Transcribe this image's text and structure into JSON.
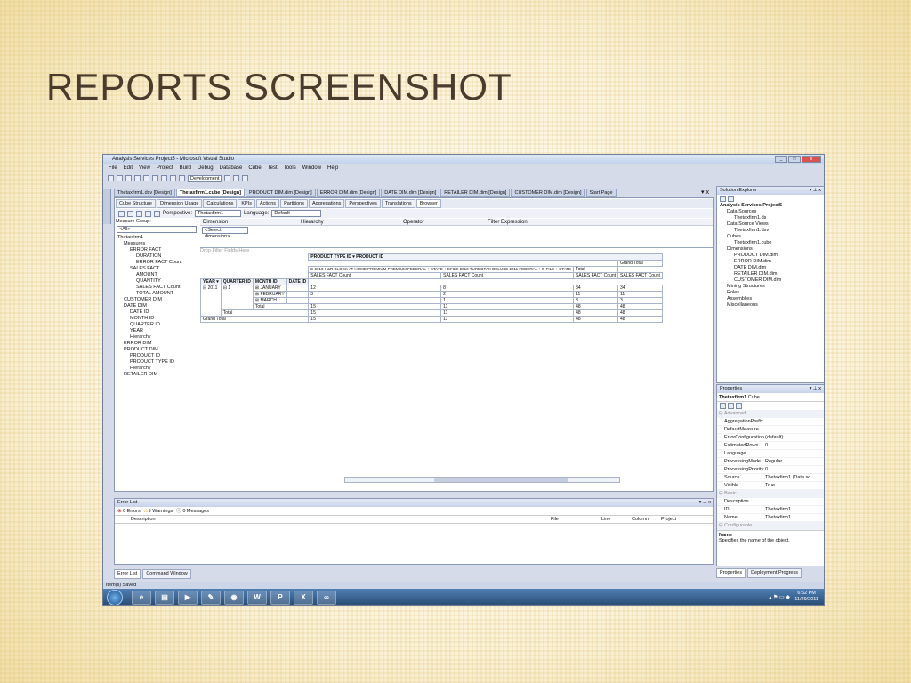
{
  "slide": {
    "title": "REPORTS SCREENSHOT"
  },
  "window": {
    "title": "Analysis Services Project5 - Microsoft Visual Studio",
    "menu": [
      "File",
      "Edit",
      "View",
      "Project",
      "Build",
      "Debug",
      "Database",
      "Cube",
      "Test",
      "Tools",
      "Window",
      "Help"
    ],
    "config": "Development"
  },
  "doc_tabs": [
    "Thetaxfirm1.dsv [Design]",
    "Thetaxfirm1.cube [Design]",
    "PRODUCT DIM.dim [Design]",
    "ERROR DIM.dim [Design]",
    "DATE DIM.dim [Design]",
    "RETAILER DIM.dim [Design]",
    "CUSTOMER DIM.dim [Design]",
    "Start Page"
  ],
  "sub_tabs": [
    "Cube Structure",
    "Dimension Usage",
    "Calculations",
    "KPIs",
    "Actions",
    "Partitions",
    "Aggregations",
    "Perspectives",
    "Translations",
    "Browser"
  ],
  "browser": {
    "perspective_label": "Perspective:",
    "perspective": "Thetaxfirm1",
    "language_label": "Language:",
    "language": "Default",
    "measure_group_label": "Measure Group:",
    "measure_group": "<All>"
  },
  "measure_tree": [
    "Thetaxfirm1",
    "Measures",
    "ERROR FACT",
    "DURATION",
    "ERROR FACT Count",
    "SALES FACT",
    "AMOUNT",
    "QUANTITY",
    "SALES FACT Count",
    "TOTAL AMOUNT",
    "CUSTOMER DIM",
    "DATE DIM",
    "DATE ID",
    "MONTH ID",
    "QUARTER ID",
    "YEAR",
    "Hierarchy",
    "ERROR DIM",
    "PRODUCT DIM",
    "PRODUCT ID",
    "PRODUCT TYPE ID",
    "Hierarchy",
    "RETAILER DIM"
  ],
  "filter": {
    "headers": [
      "Dimension",
      "Hierarchy",
      "Operator",
      "Filter Expression"
    ],
    "select_dim": "<Select dimension>"
  },
  "pivot": {
    "drop_hint": "Drop Filter Fields Here",
    "col_header": "PRODUCT TYPE ID ▾  PRODUCT ID",
    "product_header": "E 2010 H&R BLOCK AT HOME PREMIUM PREMIUM FEDERAL + STATE + EFILE 2010 TURBOTAX DELUXE 2011 FEDERAL + E-FILE + STATE",
    "total": "Total",
    "grand_total": "Grand Total",
    "measure_label": "SALES FACT Count",
    "row_headers": [
      "YEAR ▾",
      "QUARTER ID",
      "MONTH ID",
      "DATE ID"
    ],
    "year": "2011",
    "quarter": "1",
    "months": [
      "JANUARY",
      "FEBRUARY",
      "MARCH"
    ],
    "rows": [
      {
        "c1": "12",
        "c2": "8",
        "c3": "34",
        "c4": "34"
      },
      {
        "c1": "3",
        "c2": "2",
        "c3": "11",
        "c4": "11"
      },
      {
        "c1": "",
        "c2": "1",
        "c3": "3",
        "c4": "3"
      },
      {
        "c1": "15",
        "c2": "11",
        "c3": "48",
        "c4": "48"
      },
      {
        "c1": "15",
        "c2": "11",
        "c3": "48",
        "c4": "48"
      },
      {
        "c1": "15",
        "c2": "11",
        "c3": "48",
        "c4": "48"
      }
    ]
  },
  "solution": {
    "title": "Solution Explorer",
    "items": [
      "Analysis Services Project5",
      "Data Sources",
      "Thetaxfirm1.ds",
      "Data Source Views",
      "Thetaxfirm1.dsv",
      "Cubes",
      "Thetaxfirm1.cube",
      "Dimensions",
      "PRODUCT DIM.dim",
      "ERROR DIM.dim",
      "DATE DIM.dim",
      "RETAILER DIM.dim",
      "CUSTOMER DIM.dim",
      "Mining Structures",
      "Roles",
      "Assemblies",
      "Miscellaneous"
    ]
  },
  "properties": {
    "title": "Properties",
    "object": "Thetaxfirm1",
    "object_type": "Cube",
    "cat_advanced": "Advanced",
    "cat_basic": "Basic",
    "cat_configurable": "Configurable",
    "advanced": [
      {
        "k": "AggregationPrefix",
        "v": ""
      },
      {
        "k": "DefaultMeasure",
        "v": ""
      },
      {
        "k": "ErrorConfiguration",
        "v": "(default)"
      },
      {
        "k": "EstimatedRows",
        "v": "0"
      },
      {
        "k": "Language",
        "v": ""
      },
      {
        "k": "ProcessingMode",
        "v": "Regular"
      },
      {
        "k": "ProcessingPriority",
        "v": "0"
      },
      {
        "k": "Source",
        "v": "Thetaxfirm1 (Data so"
      },
      {
        "k": "Visible",
        "v": "True"
      }
    ],
    "basic": [
      {
        "k": "Description",
        "v": ""
      },
      {
        "k": "ID",
        "v": "Thetaxfirm1"
      },
      {
        "k": "Name",
        "v": "Thetaxfirm1"
      }
    ],
    "help_title": "Name",
    "help_text": "Specifies the name of the object.",
    "tabs": [
      "Properties",
      "Deployment Progress"
    ]
  },
  "errors": {
    "title": "Error List",
    "errors_btn": "0 Errors",
    "warnings_btn": "9 Warnings",
    "messages_btn": "0 Messages",
    "cols": [
      "Description",
      "File",
      "Line",
      "Column",
      "Project"
    ]
  },
  "bottom_tabs": [
    "Error List",
    "Command Window"
  ],
  "status": "Item(s) Saved",
  "taskbar": {
    "time": "6:52 PM",
    "date": "11/29/2011"
  }
}
